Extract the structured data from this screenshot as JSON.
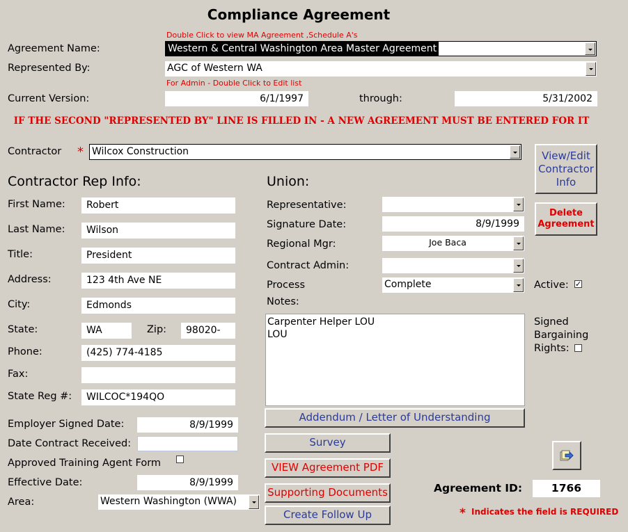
{
  "title": "Compliance Agreement",
  "hints": {
    "agreement_hint": "Double Click to view MA Agreement ,Schedule A's",
    "admin_hint": "For Admin - Double Click to Edit list"
  },
  "agreement": {
    "name_label": "Agreement Name:",
    "name_value": "Western & Central Washington Area Master Agreement",
    "rep_label": "Represented By:",
    "rep_value": "AGC of Western WA",
    "version_label": "Current Version:",
    "version_start": "6/1/1997",
    "through_label": "through:",
    "version_end": "5/31/2002"
  },
  "warning": "IF THE SECOND \"REPRESENTED BY\" LINE IS FILLED IN - A NEW AGREEMENT MUST BE ENTERED FOR IT",
  "contractor": {
    "label": "Contractor",
    "required_mark": "*",
    "value": "Wilcox Construction",
    "view_edit_button": "View/Edit Contractor Info"
  },
  "rep_info": {
    "heading": "Contractor Rep Info:",
    "first_name_label": "First Name:",
    "first_name": "Robert",
    "last_name_label": "Last Name:",
    "last_name": "Wilson",
    "title_label": "Title:",
    "title": "President",
    "address_label": "Address:",
    "address": "123 4th Ave NE",
    "city_label": "City:",
    "city": "Edmonds",
    "state_label": "State:",
    "state": "WA",
    "zip_label": "Zip:",
    "zip": "98020-",
    "phone_label": "Phone:",
    "phone": "(425) 774-4185",
    "fax_label": "Fax:",
    "fax": "",
    "state_reg_label": "State Reg #:",
    "state_reg": "WILCOC*194QO"
  },
  "dates": {
    "employer_signed_label": "Employer Signed Date:",
    "employer_signed": "8/9/1999",
    "contract_received_label": "Date Contract Received:",
    "contract_received": "",
    "training_agent_label": "Approved Training Agent Form",
    "effective_label": "Effective Date:",
    "effective": "8/9/1999",
    "area_label": "Area:",
    "area": "Western Washington (WWA)"
  },
  "union": {
    "heading": "Union:",
    "representative_label": "Representative:",
    "representative": "",
    "signature_date_label": "Signature Date:",
    "signature_date": "8/9/1999",
    "regional_mgr_label": "Regional Mgr:",
    "regional_mgr": "Joe Baca",
    "contract_admin_label": "Contract Admin:",
    "contract_admin": "",
    "process_label": "Process",
    "process": "Complete",
    "notes_label": "Notes:",
    "notes_line1": "Carpenter Helper LOU",
    "notes_line2": "LOU"
  },
  "side": {
    "delete_button": "Delete Agreement",
    "active_label": "Active:",
    "signed_bargaining_label": "Signed Bargaining Rights:"
  },
  "buttons": {
    "addendum": "Addendum / Letter of Understanding",
    "survey": "Survey",
    "view_pdf": "VIEW Agreement PDF",
    "supporting_docs": "Supporting Documents",
    "follow_up": "Create Follow Up"
  },
  "agreement_id": {
    "label": "Agreement ID:",
    "value": "1766"
  },
  "required_note": {
    "mark": "*",
    "text": "Indicates the field is REQUIRED"
  },
  "colors": {
    "background": "#d4d0c8",
    "required_red": "#e00000",
    "button_text_blue": "#2a3a9a"
  }
}
